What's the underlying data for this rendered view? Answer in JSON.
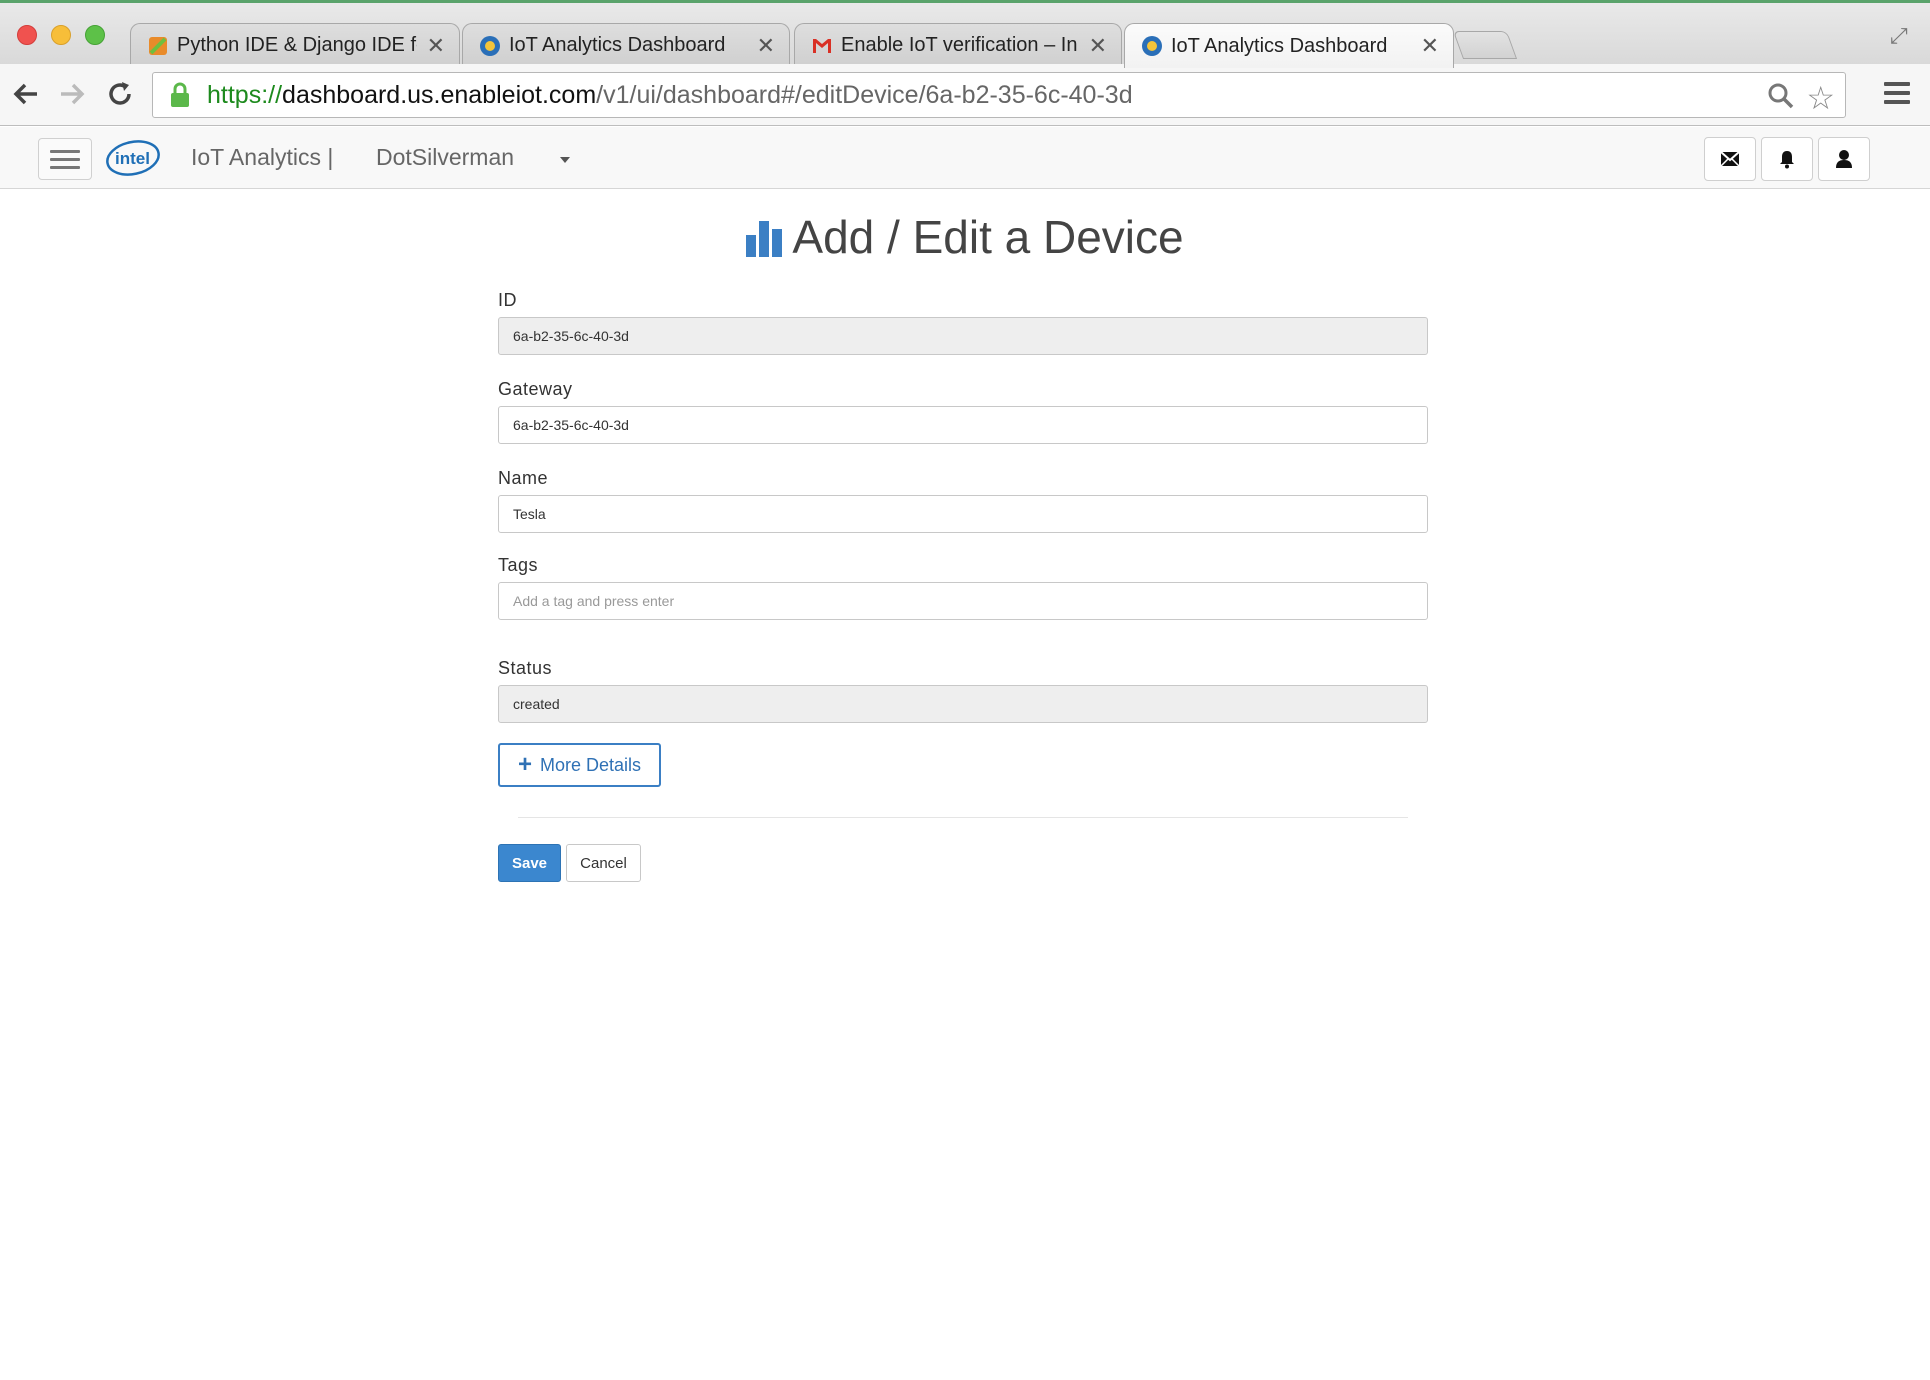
{
  "browser": {
    "tabs": [
      {
        "title": "Python IDE & Django IDE fo",
        "favicon": "pycharm-icon",
        "active": false
      },
      {
        "title": "IoT Analytics Dashboard",
        "favicon": "iot-globe-icon",
        "active": false
      },
      {
        "title": "Enable IoT verification – In",
        "favicon": "gmail-icon",
        "active": false
      },
      {
        "title": "IoT Analytics Dashboard",
        "favicon": "iot-globe-icon",
        "active": true
      }
    ],
    "url": {
      "scheme": "https://",
      "host": "dashboard.us.enableiot.com",
      "path": "/v1/ui/dashboard#/editDevice/6a-b2-35-6c-40-3d"
    }
  },
  "navbar": {
    "brand": "IoT Analytics |",
    "account": "DotSilverman",
    "icons": [
      "mail-icon",
      "bell-icon",
      "user-icon"
    ]
  },
  "page": {
    "title": "Add / Edit a Device",
    "accent_color": "#3b7fc4"
  },
  "form": {
    "id": {
      "label": "ID",
      "value": "6a-b2-35-6c-40-3d"
    },
    "gateway": {
      "label": "Gateway",
      "value": "6a-b2-35-6c-40-3d"
    },
    "name": {
      "label": "Name",
      "value": "Tesla"
    },
    "tags": {
      "label": "Tags",
      "value": "",
      "placeholder": "Add a tag and press enter"
    },
    "status": {
      "label": "Status",
      "value": "created"
    },
    "more_details_label": "More Details",
    "save_label": "Save",
    "cancel_label": "Cancel"
  }
}
